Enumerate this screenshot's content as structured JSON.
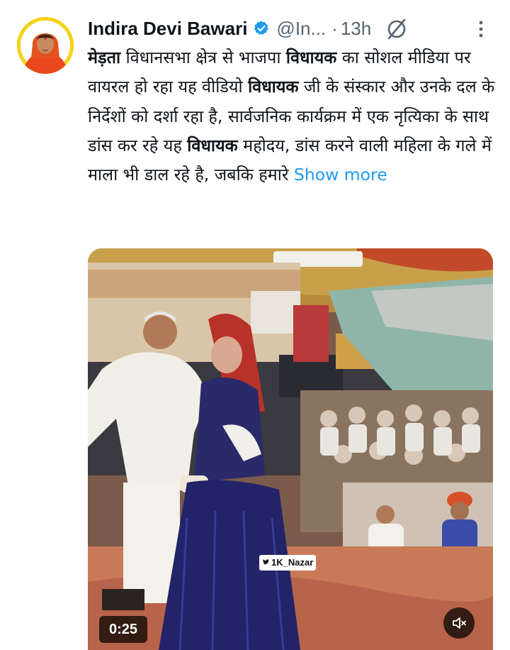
{
  "tweet": {
    "display_name": "Indira Devi Bawari",
    "handle": "@In...",
    "separator": "·",
    "time": "13h",
    "text": [
      {
        "t": "मेड़ता",
        "b": true
      },
      {
        "t": " विधानसभा क्षेत्र से भाजपा ",
        "b": false
      },
      {
        "t": "विधायक",
        "b": true
      },
      {
        "t": " का सोशल मीडिया पर वायरल हो रहा यह वीडियो ",
        "b": false
      },
      {
        "t": "विधायक",
        "b": true
      },
      {
        "t": " जी के संस्कार और उनके दल के निर्देशों को दर्शा रहा है, सार्वजनिक कार्यक्रम में एक नृत्यिका के साथ डांस कर रहे यह ",
        "b": false
      },
      {
        "t": "विधायक",
        "b": true
      },
      {
        "t": " महोदय, डांस करने वाली महिला के गले में माला भी डाल रहे है, जबकि हमारे ",
        "b": false
      }
    ],
    "show_more_label": "Show more"
  },
  "media": {
    "watermark": "1K_Nazar",
    "duration": "0:25"
  },
  "icons": {
    "verified": "verified-badge-icon",
    "hidden": "slashed-circle-icon",
    "more": "more-vertical-icon",
    "volume": "speaker-muted-icon"
  },
  "colors": {
    "link": "#1d9bf0",
    "verified": "#1d9bf0",
    "secondary_text": "#536471",
    "avatar_ring": "#f4d21a"
  }
}
